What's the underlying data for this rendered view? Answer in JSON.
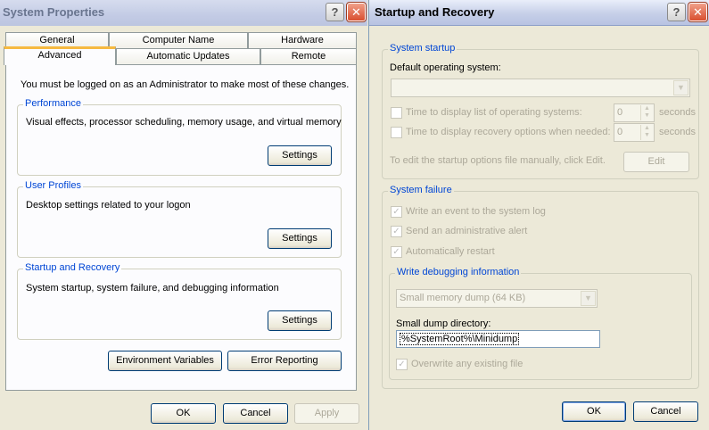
{
  "system_properties": {
    "title": "System Properties",
    "help_glyph": "?",
    "close_glyph": "✕",
    "tabs_row1": [
      "General",
      "Computer Name",
      "Hardware"
    ],
    "tabs_row2": [
      "Advanced",
      "Automatic Updates",
      "Remote"
    ],
    "admin_notice": "You must be logged on as an Administrator to make most of these changes.",
    "performance": {
      "legend": "Performance",
      "desc": "Visual effects, processor scheduling, memory usage, and virtual memory",
      "button": "Settings"
    },
    "user_profiles": {
      "legend": "User Profiles",
      "desc": "Desktop settings related to your logon",
      "button": "Settings"
    },
    "startup_recovery": {
      "legend": "Startup and Recovery",
      "desc": "System startup, system failure, and debugging information",
      "button": "Settings"
    },
    "env_vars_button": "Environment Variables",
    "error_reporting_button": "Error Reporting",
    "ok": "OK",
    "cancel": "Cancel",
    "apply": "Apply"
  },
  "startup_dialog": {
    "title": "Startup and Recovery",
    "help_glyph": "?",
    "close_glyph": "✕",
    "system_startup": {
      "legend": "System startup",
      "default_os_label": "Default operating system:",
      "default_os_value": "",
      "time_list_label": "Time to display list of operating systems:",
      "time_list_value": "0",
      "time_recovery_label": "Time to display recovery options when needed:",
      "time_recovery_value": "0",
      "seconds_unit": "seconds",
      "edit_hint": "To edit the startup options file manually, click Edit.",
      "edit_button": "Edit"
    },
    "system_failure": {
      "legend": "System failure",
      "write_event": "Write an event to the system log",
      "send_alert": "Send an administrative alert",
      "auto_restart": "Automatically restart",
      "check_glyph": "✓"
    },
    "debugging": {
      "legend": "Write debugging information",
      "dump_type": "Small memory dump (64 KB)",
      "dump_dir_label": "Small dump directory:",
      "dump_dir_value": "%SystemRoot%\\Minidump",
      "overwrite": "Overwrite any existing file"
    },
    "ok": "OK",
    "cancel": "Cancel"
  },
  "icons": {
    "combo_arrow": "▼",
    "spin_up": "▲",
    "spin_down": "▼"
  }
}
